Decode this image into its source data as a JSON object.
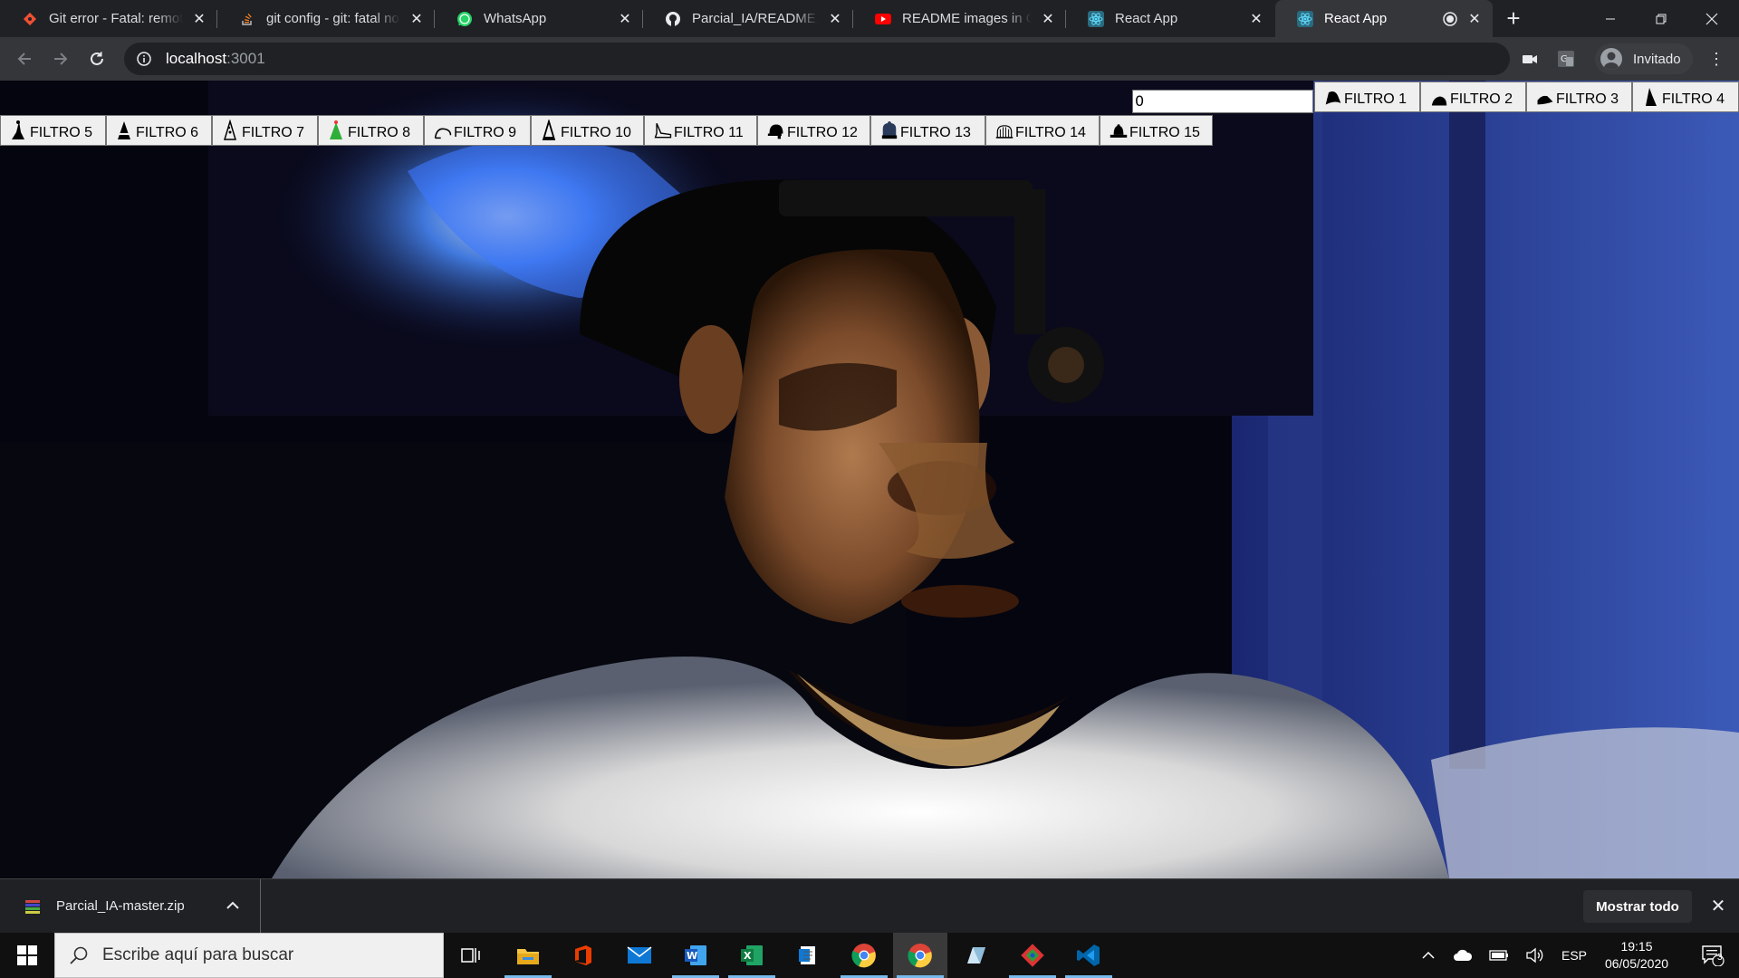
{
  "browser": {
    "tabs": [
      {
        "title": "Git error - Fatal: remote origin already exists",
        "icon": "git-icon",
        "active": false
      },
      {
        "title": "git config - git: fatal no pathspec",
        "icon": "stackoverflow-icon",
        "active": false
      },
      {
        "title": "WhatsApp",
        "icon": "whatsapp-icon",
        "active": false
      },
      {
        "title": "Parcial_IA/README.md at master",
        "icon": "github-icon",
        "active": false
      },
      {
        "title": "README images in GitHub",
        "icon": "youtube-icon",
        "active": false
      },
      {
        "title": "React App",
        "icon": "react-icon",
        "active": false
      },
      {
        "title": "React App",
        "icon": "react-icon",
        "active": true
      }
    ],
    "new_tab_symbol": "+",
    "url": {
      "host": "localhost",
      "port": ":3001"
    },
    "profile_label": "Invitado"
  },
  "app": {
    "number_input_value": "0",
    "filters": [
      {
        "label": "FILTRO 1",
        "icon": "hat-1-icon"
      },
      {
        "label": "FILTRO 2",
        "icon": "hat-2-icon"
      },
      {
        "label": "FILTRO 3",
        "icon": "hat-3-icon"
      },
      {
        "label": "FILTRO 4",
        "icon": "hat-4-icon"
      },
      {
        "label": "FILTRO 5",
        "icon": "hat-5-icon"
      },
      {
        "label": "FILTRO 6",
        "icon": "hat-6-icon"
      },
      {
        "label": "FILTRO 7",
        "icon": "hat-7-icon"
      },
      {
        "label": "FILTRO 8",
        "icon": "hat-8-icon"
      },
      {
        "label": "FILTRO 9",
        "icon": "hat-9-icon"
      },
      {
        "label": "FILTRO 10",
        "icon": "hat-10-icon"
      },
      {
        "label": "FILTRO 11",
        "icon": "hat-11-icon"
      },
      {
        "label": "FILTRO 12",
        "icon": "hat-12-icon"
      },
      {
        "label": "FILTRO 13",
        "icon": "hat-13-icon"
      },
      {
        "label": "FILTRO 14",
        "icon": "hat-14-icon"
      },
      {
        "label": "FILTRO 15",
        "icon": "hat-15-icon"
      }
    ]
  },
  "download_shelf": {
    "file_name": "Parcial_IA-master.zip",
    "show_all_label": "Mostrar todo"
  },
  "taskbar": {
    "search_placeholder": "Escribe aquí para buscar",
    "apps": [
      "task-view-icon",
      "file-explorer-icon",
      "office-icon",
      "mail-icon",
      "word-icon",
      "excel-icon",
      "notepad-icon",
      "chrome-icon",
      "chrome-icon",
      "app-icon",
      "git-icon",
      "vscode-icon"
    ],
    "language": "ESP",
    "time": "19:15",
    "date": "06/05/2020",
    "notification_count": "3"
  },
  "colors": {
    "chrome_dark": "#202124",
    "chrome_toolbar": "#35363a",
    "button_face": "#efefef",
    "taskbar": "#101010",
    "accent": "#76b9ed"
  }
}
